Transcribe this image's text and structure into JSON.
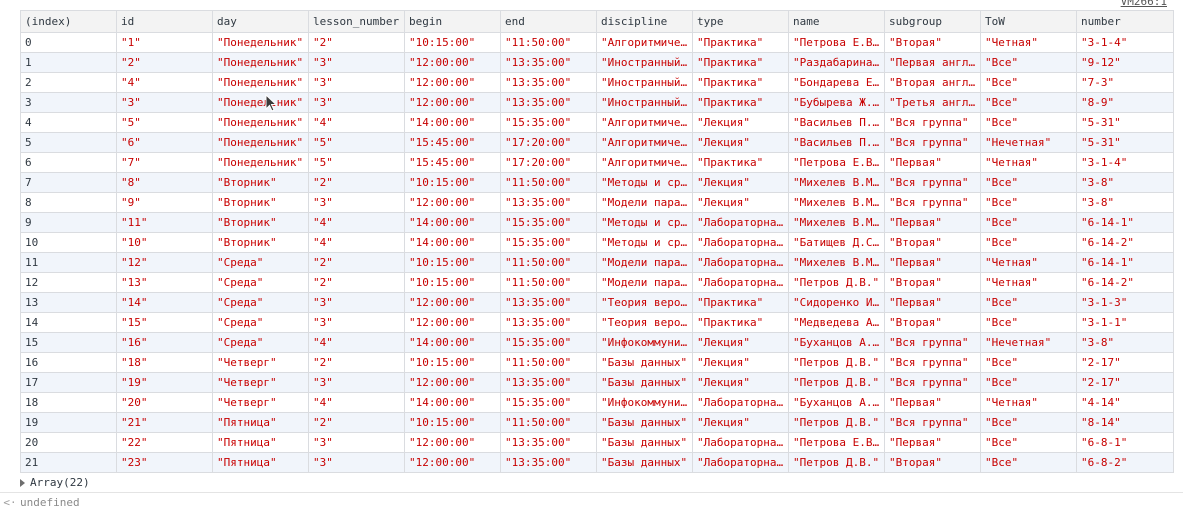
{
  "header": {
    "source_link": "VM266:1"
  },
  "table": {
    "columns": [
      "(index)",
      "id",
      "day",
      "lesson_number",
      "begin",
      "end",
      "discipline",
      "type",
      "name",
      "subgroup",
      "ToW",
      "number"
    ],
    "rows": [
      [
        "0",
        "\"1\"",
        "\"Понедельник\"",
        "\"2\"",
        "\"10:15:00\"",
        "\"11:50:00\"",
        "\"Алгоритмиче…",
        "\"Практика\"",
        "\"Петрова Е.В…",
        "\"Вторая\"",
        "\"Четная\"",
        "\"3-1-4\""
      ],
      [
        "1",
        "\"2\"",
        "\"Понедельник\"",
        "\"3\"",
        "\"12:00:00\"",
        "\"13:35:00\"",
        "\"Иностранный…",
        "\"Практика\"",
        "\"Раздабарина…",
        "\"Первая англ…",
        "\"Все\"",
        "\"9-12\""
      ],
      [
        "2",
        "\"4\"",
        "\"Понедельник\"",
        "\"3\"",
        "\"12:00:00\"",
        "\"13:35:00\"",
        "\"Иностранный…",
        "\"Практика\"",
        "\"Бондарева Е…",
        "\"Вторая англ…",
        "\"Все\"",
        "\"7-3\""
      ],
      [
        "3",
        "\"3\"",
        "\"Понедельник\"",
        "\"3\"",
        "\"12:00:00\"",
        "\"13:35:00\"",
        "\"Иностранный…",
        "\"Практика\"",
        "\"Бубырева Ж.…",
        "\"Третья англ…",
        "\"Все\"",
        "\"8-9\""
      ],
      [
        "4",
        "\"5\"",
        "\"Понедельник\"",
        "\"4\"",
        "\"14:00:00\"",
        "\"15:35:00\"",
        "\"Алгоритмиче…",
        "\"Лекция\"",
        "\"Васильев П.…",
        "\"Вся группа\"",
        "\"Все\"",
        "\"5-31\""
      ],
      [
        "5",
        "\"6\"",
        "\"Понедельник\"",
        "\"5\"",
        "\"15:45:00\"",
        "\"17:20:00\"",
        "\"Алгоритмиче…",
        "\"Лекция\"",
        "\"Васильев П.…",
        "\"Вся группа\"",
        "\"Нечетная\"",
        "\"5-31\""
      ],
      [
        "6",
        "\"7\"",
        "\"Понедельник\"",
        "\"5\"",
        "\"15:45:00\"",
        "\"17:20:00\"",
        "\"Алгоритмиче…",
        "\"Практика\"",
        "\"Петрова Е.В…",
        "\"Первая\"",
        "\"Четная\"",
        "\"3-1-4\""
      ],
      [
        "7",
        "\"8\"",
        "\"Вторник\"",
        "\"2\"",
        "\"10:15:00\"",
        "\"11:50:00\"",
        "\"Методы и ср…",
        "\"Лекция\"",
        "\"Михелев В.М…",
        "\"Вся группа\"",
        "\"Все\"",
        "\"3-8\""
      ],
      [
        "8",
        "\"9\"",
        "\"Вторник\"",
        "\"3\"",
        "\"12:00:00\"",
        "\"13:35:00\"",
        "\"Модели пара…",
        "\"Лекция\"",
        "\"Михелев В.М…",
        "\"Вся группа\"",
        "\"Все\"",
        "\"3-8\""
      ],
      [
        "9",
        "\"11\"",
        "\"Вторник\"",
        "\"4\"",
        "\"14:00:00\"",
        "\"15:35:00\"",
        "\"Методы и ср…",
        "\"Лабораторна…",
        "\"Михелев В.М…",
        "\"Первая\"",
        "\"Все\"",
        "\"6-14-1\""
      ],
      [
        "10",
        "\"10\"",
        "\"Вторник\"",
        "\"4\"",
        "\"14:00:00\"",
        "\"15:35:00\"",
        "\"Методы и ср…",
        "\"Лабораторна…",
        "\"Батищев Д.С…",
        "\"Вторая\"",
        "\"Все\"",
        "\"6-14-2\""
      ],
      [
        "11",
        "\"12\"",
        "\"Среда\"",
        "\"2\"",
        "\"10:15:00\"",
        "\"11:50:00\"",
        "\"Модели пара…",
        "\"Лабораторна…",
        "\"Михелев В.М…",
        "\"Первая\"",
        "\"Четная\"",
        "\"6-14-1\""
      ],
      [
        "12",
        "\"13\"",
        "\"Среда\"",
        "\"2\"",
        "\"10:15:00\"",
        "\"11:50:00\"",
        "\"Модели пара…",
        "\"Лабораторна…",
        "\"Петров Д.В.\"",
        "\"Вторая\"",
        "\"Четная\"",
        "\"6-14-2\""
      ],
      [
        "13",
        "\"14\"",
        "\"Среда\"",
        "\"3\"",
        "\"12:00:00\"",
        "\"13:35:00\"",
        "\"Теория веро…",
        "\"Практика\"",
        "\"Сидоренко И…",
        "\"Первая\"",
        "\"Все\"",
        "\"3-1-3\""
      ],
      [
        "14",
        "\"15\"",
        "\"Среда\"",
        "\"3\"",
        "\"12:00:00\"",
        "\"13:35:00\"",
        "\"Теория веро…",
        "\"Практика\"",
        "\"Медведева А…",
        "\"Вторая\"",
        "\"Все\"",
        "\"3-1-1\""
      ],
      [
        "15",
        "\"16\"",
        "\"Среда\"",
        "\"4\"",
        "\"14:00:00\"",
        "\"15:35:00\"",
        "\"Инфокоммуни…",
        "\"Лекция\"",
        "\"Буханцов А.…",
        "\"Вся группа\"",
        "\"Нечетная\"",
        "\"3-8\""
      ],
      [
        "16",
        "\"18\"",
        "\"Четверг\"",
        "\"2\"",
        "\"10:15:00\"",
        "\"11:50:00\"",
        "\"Базы данных\"",
        "\"Лекция\"",
        "\"Петров Д.В.\"",
        "\"Вся группа\"",
        "\"Все\"",
        "\"2-17\""
      ],
      [
        "17",
        "\"19\"",
        "\"Четверг\"",
        "\"3\"",
        "\"12:00:00\"",
        "\"13:35:00\"",
        "\"Базы данных\"",
        "\"Лекция\"",
        "\"Петров Д.В.\"",
        "\"Вся группа\"",
        "\"Все\"",
        "\"2-17\""
      ],
      [
        "18",
        "\"20\"",
        "\"Четверг\"",
        "\"4\"",
        "\"14:00:00\"",
        "\"15:35:00\"",
        "\"Инфокоммуни…",
        "\"Лабораторна…",
        "\"Буханцов А.…",
        "\"Первая\"",
        "\"Четная\"",
        "\"4-14\""
      ],
      [
        "19",
        "\"21\"",
        "\"Пятница\"",
        "\"2\"",
        "\"10:15:00\"",
        "\"11:50:00\"",
        "\"Базы данных\"",
        "\"Лекция\"",
        "\"Петров Д.В.\"",
        "\"Вся группа\"",
        "\"Все\"",
        "\"8-14\""
      ],
      [
        "20",
        "\"22\"",
        "\"Пятница\"",
        "\"3\"",
        "\"12:00:00\"",
        "\"13:35:00\"",
        "\"Базы данных\"",
        "\"Лабораторна…",
        "\"Петрова Е.В…",
        "\"Первая\"",
        "\"Все\"",
        "\"6-8-1\""
      ],
      [
        "21",
        "\"23\"",
        "\"Пятница\"",
        "\"3\"",
        "\"12:00:00\"",
        "\"13:35:00\"",
        "\"Базы данных\"",
        "\"Лабораторна…",
        "\"Петров Д.В.\"",
        "\"Вторая\"",
        "\"Все\"",
        "\"6-8-2\""
      ]
    ]
  },
  "array_summary": {
    "label": "Array(22)",
    "icon": "expand-triangle-icon"
  },
  "result": {
    "icon": "return-arrow-icon",
    "arrow": "<·",
    "value": "undefined"
  },
  "colors": {
    "string_value": "#c80000",
    "header_bg": "#f3f3f3",
    "stripe_bg": "#f1f5fb",
    "border": "#dadce0"
  }
}
